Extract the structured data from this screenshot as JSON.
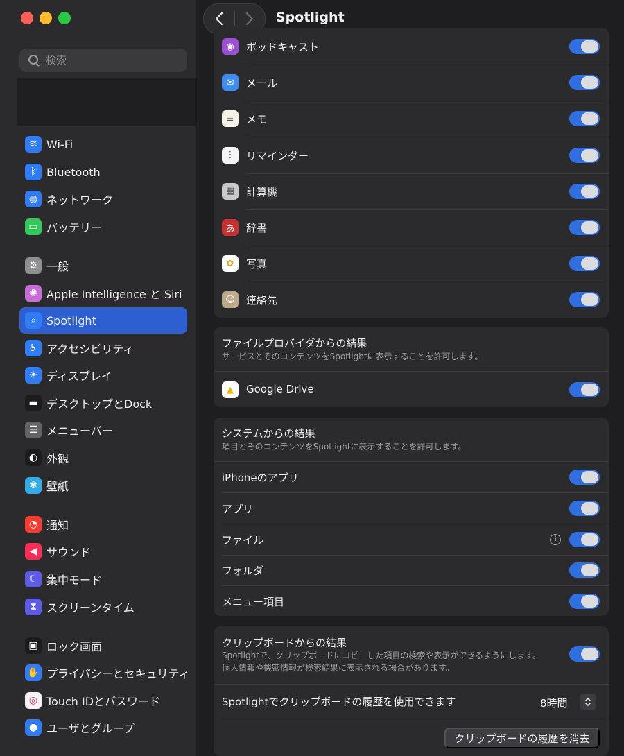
{
  "window": {
    "title": "Spotlight"
  },
  "sidebar": {
    "search_placeholder": "検索",
    "items": [
      {
        "label": "Wi-Fi",
        "icon": "wifi-icon",
        "color": "#2f7cf6"
      },
      {
        "label": "Bluetooth",
        "icon": "bluetooth-icon",
        "color": "#2f7cf6"
      },
      {
        "label": "ネットワーク",
        "icon": "globe-icon",
        "color": "#2f7cf6"
      },
      {
        "label": "バッテリー",
        "icon": "battery-icon",
        "color": "#34c759"
      },
      {
        "label": "一般",
        "icon": "gear-icon",
        "color": "#8e8e93"
      },
      {
        "label": "Apple Intelligence と Siri",
        "icon": "siri-icon",
        "color": "#c86dd7"
      },
      {
        "label": "Spotlight",
        "icon": "magnifier-icon",
        "color": "#2f7cf6",
        "active": true
      },
      {
        "label": "アクセシビリティ",
        "icon": "accessibility-icon",
        "color": "#2f7cf6"
      },
      {
        "label": "ディスプレイ",
        "icon": "sun-icon",
        "color": "#2f7cf6"
      },
      {
        "label": "デスクトップとDock",
        "icon": "dock-icon",
        "color": "#1c1c1e"
      },
      {
        "label": "メニューバー",
        "icon": "menubar-icon",
        "color": "#636366"
      },
      {
        "label": "外観",
        "icon": "appearance-icon",
        "color": "#1c1c1e"
      },
      {
        "label": "壁紙",
        "icon": "wallpaper-icon",
        "color": "#32ade6"
      },
      {
        "label": "通知",
        "icon": "bell-icon",
        "color": "#ff3b30"
      },
      {
        "label": "サウンド",
        "icon": "speaker-icon",
        "color": "#ff2d55"
      },
      {
        "label": "集中モード",
        "icon": "moon-icon",
        "color": "#5e5ce6"
      },
      {
        "label": "スクリーンタイム",
        "icon": "hourglass-icon",
        "color": "#5e5ce6"
      },
      {
        "label": "ロック画面",
        "icon": "lock-icon",
        "color": "#1c1c1e"
      },
      {
        "label": "プライバシーとセキュリティ",
        "icon": "hand-icon",
        "color": "#2f7cf6"
      },
      {
        "label": "Touch IDとパスワード",
        "icon": "fingerprint-icon",
        "color": "#f2f2f7"
      },
      {
        "label": "ユーザとグループ",
        "icon": "users-icon",
        "color": "#2f7cf6"
      }
    ]
  },
  "apps": [
    {
      "label": "ポッドキャスト",
      "icon": "podcasts-icon",
      "color": "#9b4fd6",
      "glyph": "◉",
      "on": true
    },
    {
      "label": "メール",
      "icon": "mail-icon",
      "color": "#3d8ef0",
      "glyph": "✉",
      "on": true
    },
    {
      "label": "メモ",
      "icon": "notes-icon",
      "color": "#f5f3e8",
      "glyph": "≡",
      "on": true
    },
    {
      "label": "リマインダー",
      "icon": "reminders-icon",
      "color": "#f5f5f7",
      "glyph": "⋮",
      "on": true
    },
    {
      "label": "計算機",
      "icon": "calculator-icon",
      "color": "#c7c7cc",
      "glyph": "▦",
      "on": true
    },
    {
      "label": "辞書",
      "icon": "dictionary-icon",
      "color": "#c8312f",
      "glyph": "あ",
      "on": true
    },
    {
      "label": "写真",
      "icon": "photos-icon",
      "color": "#ffffff",
      "glyph": "✿",
      "on": true
    },
    {
      "label": "連絡先",
      "icon": "contacts-icon",
      "color": "#bfa98b",
      "glyph": "☺",
      "on": true
    }
  ],
  "file_providers": {
    "title": "ファイルプロバイダからの結果",
    "description": "サービスとそのコンテンツをSpotlightに表示することを許可します。",
    "items": [
      {
        "label": "Google Drive",
        "icon": "google-drive-icon",
        "color": "#ffffff",
        "glyph": "▲",
        "on": true
      }
    ]
  },
  "system_results": {
    "title": "システムからの結果",
    "description": "項目とそのコンテンツをSpotlightに表示することを許可します。",
    "items": [
      {
        "label": "iPhoneのアプリ",
        "on": true
      },
      {
        "label": "アプリ",
        "on": true
      },
      {
        "label": "ファイル",
        "on": true,
        "info": true
      },
      {
        "label": "フォルダ",
        "on": true
      },
      {
        "label": "メニュー項目",
        "on": true
      }
    ]
  },
  "clipboard": {
    "title": "クリップボードからの結果",
    "description_1": "Spotlightで、クリップボードにコピーした項目の検索や表示ができるようにします。",
    "description_2": "個人情報や機密情報が検索結果に表示される場合があります。",
    "on": true,
    "history_label": "Spotlightでクリップボードの履歴を使用できます",
    "history_value": "8時間",
    "clear_button": "クリップボードの履歴を消去"
  }
}
